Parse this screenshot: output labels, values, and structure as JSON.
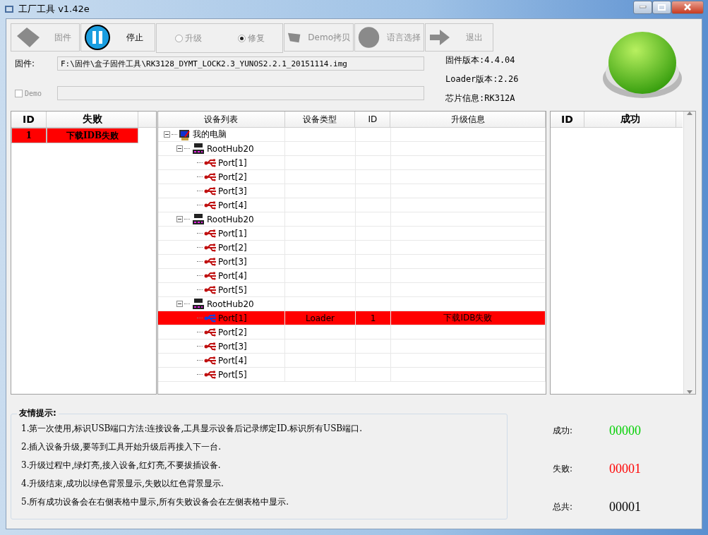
{
  "window": {
    "title": "工厂工具 v1.42e"
  },
  "toolbar": [
    {
      "kind": "button",
      "label": "固件",
      "disabled": true
    },
    {
      "kind": "button",
      "label": "停止",
      "disabled": false
    },
    {
      "kind": "radio",
      "label": "升级",
      "selected": false
    },
    {
      "kind": "radio",
      "label": "修复",
      "selected": true
    },
    {
      "kind": "button",
      "label": "Demo拷贝",
      "disabled": true
    },
    {
      "kind": "button",
      "label": "语言选择",
      "disabled": true
    },
    {
      "kind": "button",
      "label": "退出",
      "disabled": true
    }
  ],
  "firmware": {
    "label": "固件:",
    "value": "F:\\固件\\盒子固件工具\\RK3128_DYMT_LOCK2.3_YUNOS2.2.1_20151114.img"
  },
  "demo": {
    "label": "Demo",
    "checked": false
  },
  "info": [
    "固件版本:4.4.04",
    "Loader版本:2.26",
    "芯片信息:RK312A"
  ],
  "status_light": {
    "on": true
  },
  "failed_table": {
    "columns": [
      "ID",
      "失败"
    ],
    "rows": [
      {
        "id": "1",
        "message": "下载IDB失败"
      }
    ]
  },
  "device_tree": {
    "columns": [
      "设备列表",
      "设备类型",
      "ID",
      "升级信息"
    ],
    "items": [
      {
        "kind": "computer",
        "label": "我的电脑",
        "expanded": true,
        "children": [
          {
            "kind": "hub",
            "label": "RootHub20",
            "expanded": true,
            "children": [
              {
                "kind": "port",
                "label": "Port[1]",
                "failed": false
              },
              {
                "kind": "port",
                "label": "Port[2]",
                "failed": false
              },
              {
                "kind": "port",
                "label": "Port[3]",
                "failed": false
              },
              {
                "kind": "port",
                "label": "Port[4]",
                "failed": false
              }
            ]
          },
          {
            "kind": "hub",
            "label": "RootHub20",
            "expanded": true,
            "children": [
              {
                "kind": "port",
                "label": "Port[1]",
                "failed": false
              },
              {
                "kind": "port",
                "label": "Port[2]",
                "failed": false
              },
              {
                "kind": "port",
                "label": "Port[3]",
                "failed": false
              },
              {
                "kind": "port",
                "label": "Port[4]",
                "failed": false
              },
              {
                "kind": "port",
                "label": "Port[5]",
                "failed": false
              }
            ]
          },
          {
            "kind": "hub",
            "label": "RootHub20",
            "expanded": true,
            "children": [
              {
                "kind": "port",
                "label": "Port[1]",
                "failed": true,
                "connected": true,
                "device_type": "Loader",
                "id": "1",
                "info": "下载IDB失败"
              },
              {
                "kind": "port",
                "label": "Port[2]",
                "failed": false
              },
              {
                "kind": "port",
                "label": "Port[3]",
                "failed": false
              },
              {
                "kind": "port",
                "label": "Port[4]",
                "failed": false
              },
              {
                "kind": "port",
                "label": "Port[5]",
                "failed": false
              }
            ]
          }
        ]
      }
    ]
  },
  "success_table": {
    "columns": [
      "ID",
      "成功"
    ]
  },
  "tips": {
    "title": "友情提示:",
    "lines": [
      "1.第一次使用,标识USB端口方法:连接设备,工具显示设备后记录绑定ID.标识所有USB端口.",
      "2.插入设备升级,要等到工具开始升级后再接入下一台.",
      "3.升级过程中,绿灯亮,接入设备,红灯亮,不要拔插设备.",
      "4.升级结束,成功以绿色背景显示,失败以红色背景显示.",
      "5.所有成功设备会在右侧表格中显示,所有失败设备会在左侧表格中显示."
    ]
  },
  "stats": [
    {
      "label": "成功:",
      "value": "00000",
      "color": "#00d000"
    },
    {
      "label": "失败:",
      "value": "00001",
      "color": "#ff0000"
    },
    {
      "label": "总共:",
      "value": "00001",
      "color": "#000000"
    }
  ]
}
